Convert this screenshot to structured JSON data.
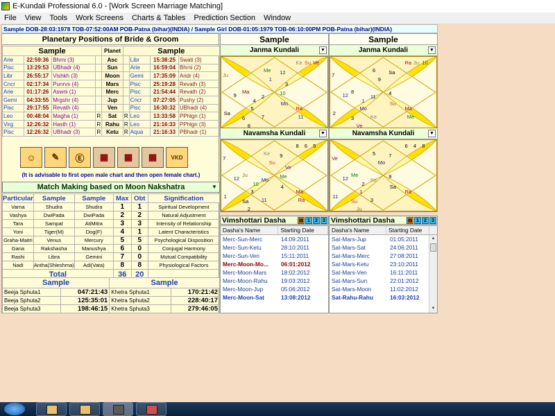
{
  "window": {
    "title": "E-Kundali Professional 6.0 - [Work Screen Marriage Matching]"
  },
  "menu": [
    "File",
    "View",
    "Tools",
    "Work Screens",
    "Charts & Tables",
    "Prediction Section",
    "Window"
  ],
  "info_line": "Sample DOB-28:03:1978 TOB-07:52:00AM POB-Patna (bihar)(INDIA) / Sample Girl DOB-01:05:1979 TOB-06:10:00PM POB-Patna (bihar)(INDIA)",
  "planetary": {
    "title": "Planetary Positions of Bride & Groom",
    "left_label": "Sample",
    "planet_label": "Planet",
    "right_label": "Sample",
    "rows": [
      {
        "s1": "Arie",
        "d1": "22:59:36",
        "n1": "Bhrni (3)",
        "r1": "",
        "p": "Asc",
        "r2": "",
        "s2": "Libr",
        "d2": "15:38:25",
        "n2": "Swati (3)"
      },
      {
        "s1": "Pisc",
        "d1": "13:29:53",
        "n1": "UBhadr (4)",
        "r1": "",
        "p": "Sun",
        "r2": "",
        "s2": "Arie",
        "d2": "16:59:04",
        "n2": "Bhrni (2)"
      },
      {
        "s1": "Libr",
        "d1": "26:55:17",
        "n1": "Vishkh (3)",
        "r1": "",
        "p": "Moon",
        "r2": "",
        "s2": "Gemi",
        "d2": "17:35:09",
        "n2": "Aridr (4)"
      },
      {
        "s1": "Cncr",
        "d1": "02:17:34",
        "n1": "Punrvs (4)",
        "r1": "",
        "p": "Mars",
        "r2": "",
        "s2": "Pisc",
        "d2": "25:19:28",
        "n2": "Revath (3)"
      },
      {
        "s1": "Arie",
        "d1": "01:17:26",
        "n1": "Aswni (1)",
        "r1": "",
        "p": "Merc",
        "r2": "",
        "s2": "Pisc",
        "d2": "21:54:44",
        "n2": "Revath (2)"
      },
      {
        "s1": "Gemi",
        "d1": "04:33:55",
        "n1": "Mrgshr (4)",
        "r1": "",
        "p": "Jup",
        "r2": "",
        "s2": "Cncr",
        "d2": "07:27:05",
        "n2": "Pushy (2)"
      },
      {
        "s1": "Pisc",
        "d1": "29:17:55",
        "n1": "Revath (4)",
        "r1": "",
        "p": "Ven",
        "r2": "",
        "s2": "Pisc",
        "d2": "16:30:32",
        "n2": "UBhadr (4)"
      },
      {
        "s1": "Leo",
        "d1": "00:48:04",
        "n1": "Magha (1)",
        "r1": "R",
        "p": "Sat",
        "r2": "R",
        "s2": "Leo",
        "d2": "13:33:58",
        "n2": "PPhlgn (1)"
      },
      {
        "s1": "Virg",
        "d1": "12:26:32",
        "n1": "Hasth (1)",
        "r1": "R",
        "p": "Rahu",
        "r2": "R",
        "s2": "Leo",
        "d2": "21:16:33",
        "n2": "PPhlgn (3)"
      },
      {
        "s1": "Pisc",
        "d1": "12:26:32",
        "n1": "UBhadr (3)",
        "r1": "R",
        "p": "Ketu",
        "r2": "R",
        "s2": "Aqua",
        "d2": "21:16:33",
        "n2": "PBhadr (1)"
      }
    ]
  },
  "toolbar_icons": [
    "person-search-icon",
    "compass-book-icon",
    "e-coin-icon",
    "kundali-chart-icon",
    "kundali-chart-icon-2",
    "kundali-chart-icon-3",
    "vkd-icon"
  ],
  "advise": "(It is advisable to first open male chart and then open female chart.)",
  "match": {
    "title": "Match Making based on Moon Nakshatra",
    "headers": [
      "Particular",
      "Sample",
      "Sample",
      "Max",
      "Obt",
      "Signification"
    ],
    "rows": [
      [
        "Varna",
        "Shudra",
        "Shudra",
        "1",
        "1",
        "Spiritual Development"
      ],
      [
        "Vashya",
        "DwiPada",
        "DwiPada",
        "2",
        "2",
        "Natural Adjustment"
      ],
      [
        "Tara",
        "Sampat",
        "AtiMitra",
        "3",
        "3",
        "Intensity of Relationship"
      ],
      [
        "Yoni",
        "Tiger(M)",
        "Dog(F)",
        "4",
        "1",
        "Latent Characteristics"
      ],
      [
        "Graha-Maitri",
        "Venus",
        "Mercury",
        "5",
        "5",
        "Psychological Disposition"
      ],
      [
        "Gana",
        "Rakshasha",
        "Manushya",
        "6",
        "0",
        "Conjugal Harmony"
      ],
      [
        "Rashi",
        "Libra",
        "Gemini",
        "7",
        "0",
        "Mutual Compatibility"
      ],
      [
        "Nadi",
        "Antha(Shleshma)",
        "Adi(Vata)",
        "8",
        "8",
        "Physiological Factors"
      ]
    ],
    "total_label": "Total",
    "total_max": "36",
    "total_obt": "20"
  },
  "sphuta": {
    "left_label": "Sample",
    "right_label": "Sample",
    "rows": [
      {
        "l": "Beeja Sphuta1",
        "lv": "047:21:43",
        "r": "Khetra Sphuta1",
        "rv": "170:21:42"
      },
      {
        "l": "Beeja Sphuta2",
        "lv": "125:35:01",
        "r": "Khetra Sphuta2",
        "rv": "228:40:17"
      },
      {
        "l": "Beeja Sphuta3",
        "lv": "198:46:15",
        "r": "Khetra Sphuta3",
        "rv": "279:46:05"
      }
    ]
  },
  "kundali": {
    "left": {
      "name": "Sample",
      "janma_label": "Janma Kundali",
      "navamsha_label": "Navamsha Kundali",
      "janma_marks": [
        {
          "t": "1",
          "c": "#1a1a8a"
        },
        {
          "t": "Ma",
          "c": "#8b0000"
        },
        {
          "t": "Me",
          "c": "#008000"
        },
        {
          "t": "12",
          "c": "#1a1a8a"
        },
        {
          "t": "Ke",
          "c": "#808080"
        },
        {
          "t": "Su",
          "c": "#c05000"
        },
        {
          "t": "Ve",
          "c": "#800080"
        },
        {
          "t": "Ju",
          "c": "#808000"
        },
        {
          "t": "2",
          "c": "#000"
        },
        {
          "t": "4",
          "c": "#000"
        },
        {
          "t": "10",
          "c": "#008000"
        },
        {
          "t": "Mo",
          "c": "#1a1a8a"
        },
        {
          "t": "5",
          "c": "#000"
        },
        {
          "t": "7",
          "c": "#000"
        },
        {
          "t": "9",
          "c": "#000"
        },
        {
          "t": "Sa",
          "c": "#000"
        },
        {
          "t": "6",
          "c": "#000"
        },
        {
          "t": "8",
          "c": "#000"
        },
        {
          "t": "Ra",
          "c": "#c00000"
        },
        {
          "t": "11",
          "c": "#1a1a8a"
        },
        {
          "t": "3",
          "c": "#000"
        }
      ],
      "navamsha_marks": [
        {
          "t": "Su",
          "c": "#c05000"
        },
        {
          "t": "Ju",
          "c": "#808000"
        },
        {
          "t": "Ke",
          "c": "#808080"
        },
        {
          "t": "9",
          "c": "#000"
        },
        {
          "t": "8",
          "c": "#000"
        },
        {
          "t": "6",
          "c": "#000"
        },
        {
          "t": "5",
          "c": "#000"
        },
        {
          "t": "7",
          "c": "#000"
        },
        {
          "t": "Mo",
          "c": "#1a1a8a"
        },
        {
          "t": "10",
          "c": "#008000"
        },
        {
          "t": "Me",
          "c": "#008000"
        },
        {
          "t": "4",
          "c": "#000"
        },
        {
          "t": "3",
          "c": "#000"
        },
        {
          "t": "11",
          "c": "#1a1a8a"
        },
        {
          "t": "12",
          "c": "#1a1a8a"
        },
        {
          "t": "1",
          "c": "#1a1a8a"
        },
        {
          "t": "Sa",
          "c": "#000"
        },
        {
          "t": "2",
          "c": "#000"
        },
        {
          "t": "Ma",
          "c": "#8b0000"
        },
        {
          "t": "Ra",
          "c": "#c00000"
        },
        {
          "t": "Ve",
          "c": "#800080"
        }
      ]
    },
    "right": {
      "name": "Sample",
      "janma_label": "Janma Kundali",
      "navamsha_label": "Navamsha Kundali",
      "janma_marks": [
        {
          "t": "9",
          "c": "#000"
        },
        {
          "t": "8",
          "c": "#000"
        },
        {
          "t": "6",
          "c": "#000"
        },
        {
          "t": "Sa",
          "c": "#000"
        },
        {
          "t": "Ra",
          "c": "#c00000"
        },
        {
          "t": "Ju",
          "c": "#808000"
        },
        {
          "t": "10",
          "c": "#008000"
        },
        {
          "t": "7",
          "c": "#000"
        },
        {
          "t": "11",
          "c": "#1a1a8a"
        },
        {
          "t": "1",
          "c": "#1a1a8a"
        },
        {
          "t": "4",
          "c": "#000"
        },
        {
          "t": "Su",
          "c": "#c05000"
        },
        {
          "t": "Mo",
          "c": "#1a1a8a"
        },
        {
          "t": "Ke",
          "c": "#808080"
        },
        {
          "t": "12",
          "c": "#1a1a8a"
        },
        {
          "t": "2",
          "c": "#000"
        },
        {
          "t": "3",
          "c": "#000"
        },
        {
          "t": "Ve",
          "c": "#800080"
        },
        {
          "t": "Ma",
          "c": "#8b0000"
        },
        {
          "t": "Me",
          "c": "#008000"
        }
      ],
      "navamsha_marks": [
        {
          "t": "Mo",
          "c": "#1a1a8a"
        },
        {
          "t": "Me",
          "c": "#008000"
        },
        {
          "t": "5",
          "c": "#000"
        },
        {
          "t": "7",
          "c": "#000"
        },
        {
          "t": "6",
          "c": "#000"
        },
        {
          "t": "4",
          "c": "#000"
        },
        {
          "t": "8",
          "c": "#000"
        },
        {
          "t": "Ve",
          "c": "#800080"
        },
        {
          "t": "Ke",
          "c": "#808080"
        },
        {
          "t": "2",
          "c": "#000"
        },
        {
          "t": "9",
          "c": "#000"
        },
        {
          "t": "Sa",
          "c": "#000"
        },
        {
          "t": "1",
          "c": "#1a1a8a"
        },
        {
          "t": "3",
          "c": "#000"
        },
        {
          "t": "12",
          "c": "#1a1a8a"
        },
        {
          "t": "11",
          "c": "#1a1a8a"
        },
        {
          "t": "Su",
          "c": "#c05000"
        },
        {
          "t": "Ju",
          "c": "#808000"
        },
        {
          "t": "Ra",
          "c": "#c00000"
        }
      ]
    }
  },
  "dasha": {
    "left": {
      "title": "Vimshottari Dasha",
      "buttons": [
        "1",
        "2",
        "3"
      ],
      "headers": [
        "Dasha's Name",
        "Starting Date"
      ],
      "rows": [
        {
          "n": "Merc-Sun-Merc",
          "d": "14:09:2011",
          "s": ""
        },
        {
          "n": "Merc-Sun-Ketu",
          "d": "28:10:2011",
          "s": ""
        },
        {
          "n": "Merc-Sun-Ven",
          "d": "15:11:2011",
          "s": ""
        },
        {
          "n": "Merc-Moon-Mo...",
          "d": "06:01:2012",
          "s": "cur"
        },
        {
          "n": "Merc-Moon-Mars",
          "d": "18:02:2012",
          "s": ""
        },
        {
          "n": "Merc-Moon-Rahu",
          "d": "19:03:2012",
          "s": ""
        },
        {
          "n": "Merc-Moon-Jup",
          "d": "05:06:2012",
          "s": ""
        },
        {
          "n": "Merc-Moon-Sat",
          "d": "13:08:2012",
          "s": "hl"
        }
      ]
    },
    "right": {
      "title": "Vimshottari Dasha",
      "buttons": [
        "1",
        "2",
        "3"
      ],
      "headers": [
        "Dasha's Name",
        "Starting Date"
      ],
      "rows": [
        {
          "n": "Sat-Mars-Jup",
          "d": "01:05:2011",
          "s": ""
        },
        {
          "n": "Sat-Mars-Sat",
          "d": "24:06:2011",
          "s": ""
        },
        {
          "n": "Sat-Mars-Merc",
          "d": "27:08:2011",
          "s": ""
        },
        {
          "n": "Sat-Mars-Ketu",
          "d": "23:10:2011",
          "s": ""
        },
        {
          "n": "Sat-Mars-Ven",
          "d": "16:11:2011",
          "s": ""
        },
        {
          "n": "Sat-Mars-Sun",
          "d": "22:01:2012",
          "s": ""
        },
        {
          "n": "Sat-Mars-Moon",
          "d": "11:02:2012",
          "s": ""
        },
        {
          "n": "Sat-Rahu-Rahu",
          "d": "16:03:2012",
          "s": "hl"
        }
      ]
    }
  },
  "colors": {
    "panel_bg": "#fffdd8",
    "chart_bg": "#ffe000",
    "desktop": "#f5dcc3",
    "accent": "#1a3fb0"
  }
}
